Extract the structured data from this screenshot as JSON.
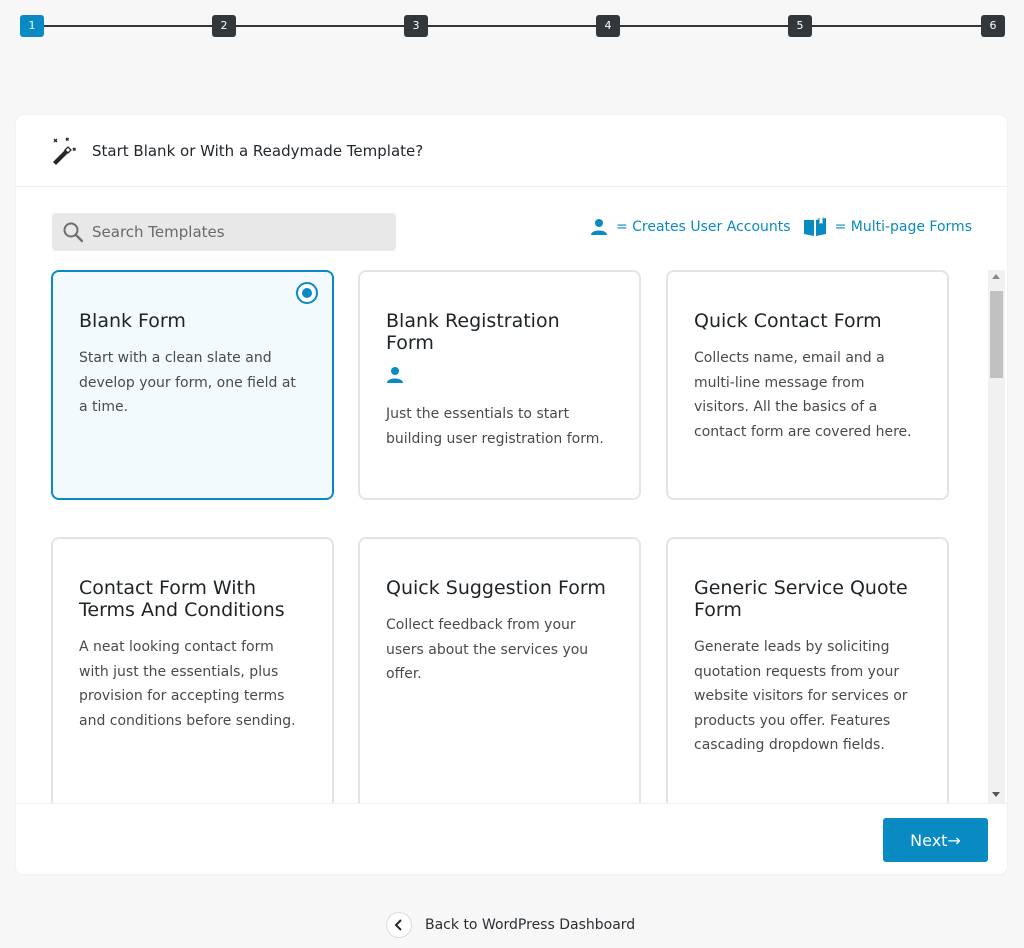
{
  "stepper": {
    "steps": [
      "1",
      "2",
      "3",
      "4",
      "5",
      "6"
    ],
    "active_index": 0
  },
  "header": {
    "title": "Start Blank or With a Readymade Template?",
    "icon": "magic-wand-icon"
  },
  "search": {
    "placeholder": "Search Templates",
    "value": "",
    "icon": "search-icon"
  },
  "legend": {
    "user_accounts": "= Creates User Accounts",
    "multi_page": "= Multi-page Forms"
  },
  "templates": [
    {
      "name": "Blank Form",
      "description": "Start with a clean slate and develop your form, one field at a time.",
      "selected": true,
      "creates_user": false
    },
    {
      "name": "Blank Registration Form",
      "description": "Just the essentials to start building user registration form.",
      "selected": false,
      "creates_user": true
    },
    {
      "name": "Quick Contact Form",
      "description": "Collects name, email and a multi-line message from visitors. All the basics of a contact form are covered here.",
      "selected": false,
      "creates_user": false
    },
    {
      "name": "Contact Form With Terms And Conditions",
      "description": "A neat looking contact form with just the essentials, plus provision for accepting terms and conditions before sending.",
      "selected": false,
      "creates_user": false
    },
    {
      "name": "Quick Suggestion Form",
      "description": "Collect feedback from your users about the services you offer.",
      "selected": false,
      "creates_user": false
    },
    {
      "name": "Generic Service Quote Form",
      "description": "Generate leads by soliciting quotation requests from your website visitors for services or products you offer. Features cascading dropdown fields.",
      "selected": false,
      "creates_user": false
    }
  ],
  "footer": {
    "next_label": "Next→"
  },
  "back_link": {
    "label": "Back to WordPress Dashboard"
  },
  "colors": {
    "accent": "#0a8ac3",
    "step_inactive": "#32373c"
  }
}
